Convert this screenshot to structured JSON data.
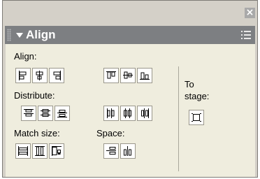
{
  "panel": {
    "title": "Align",
    "close_label": "×"
  },
  "sections": {
    "align": "Align:",
    "distribute": "Distribute:",
    "match_size": "Match size:",
    "space": "Space:",
    "to_stage_line1": "To",
    "to_stage_line2": "stage:"
  },
  "icons": {
    "align": [
      "align-left-edge-icon",
      "align-horizontal-center-icon",
      "align-right-edge-icon",
      "align-top-edge-icon",
      "align-vertical-center-icon",
      "align-bottom-edge-icon"
    ],
    "distribute": [
      "distribute-top-edge-icon",
      "distribute-vertical-center-icon",
      "distribute-bottom-edge-icon",
      "distribute-left-edge-icon",
      "distribute-horizontal-center-icon",
      "distribute-right-edge-icon"
    ],
    "match_size": [
      "match-width-icon",
      "match-height-icon",
      "match-width-and-height-icon"
    ],
    "space": [
      "space-evenly-vertically-icon",
      "space-evenly-horizontally-icon"
    ],
    "to_stage": "to-stage-icon"
  }
}
